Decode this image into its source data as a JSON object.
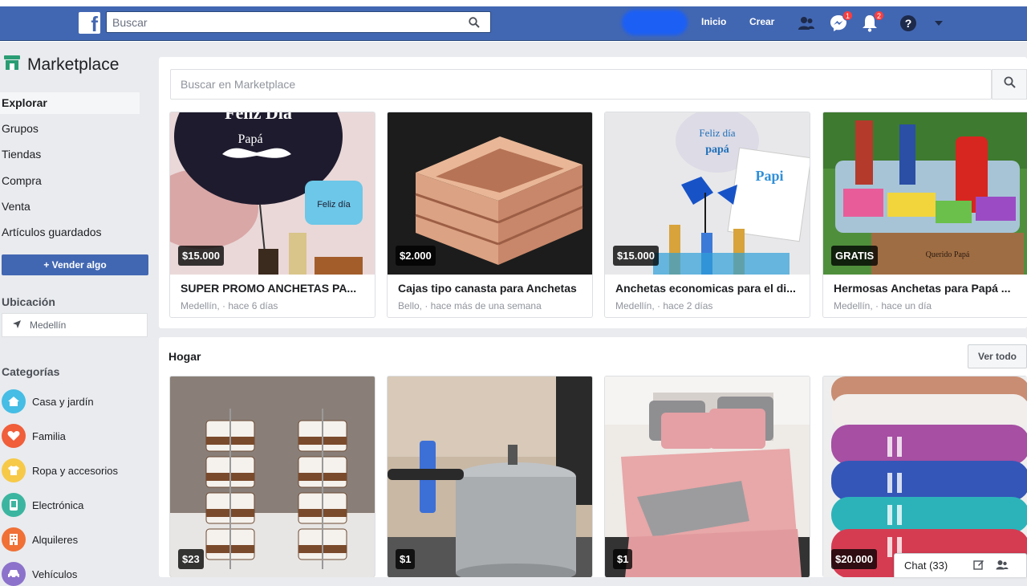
{
  "colors": {
    "brand": "#4267b2",
    "sell_button": "#4267b2",
    "badge": "#fa3e3e"
  },
  "topbar": {
    "search_placeholder": "Buscar",
    "home_label": "Inicio",
    "create_label": "Crear",
    "messages_badge": "1",
    "notifications_badge": "2"
  },
  "sidebar": {
    "title": "Marketplace",
    "items": [
      {
        "label": "Explorar",
        "active": true
      },
      {
        "label": "Grupos"
      },
      {
        "label": "Tiendas"
      },
      {
        "label": "Compra"
      },
      {
        "label": "Venta"
      },
      {
        "label": "Artículos guardados"
      }
    ],
    "sell_button": "+ Vender algo",
    "location_header": "Ubicación",
    "location_value": "Medellín",
    "categories_header": "Categorías",
    "categories": [
      {
        "label": "Casa y jardín",
        "icon": "house-icon",
        "color": "#45bde5"
      },
      {
        "label": "Familia",
        "icon": "heart-icon",
        "color": "#f05e3a"
      },
      {
        "label": "Ropa y accesorios",
        "icon": "shirt-icon",
        "color": "#f7c948"
      },
      {
        "label": "Electrónica",
        "icon": "phone-icon",
        "color": "#3cb5a0"
      },
      {
        "label": "Alquileres",
        "icon": "building-icon",
        "color": "#f07036"
      },
      {
        "label": "Vehículos",
        "icon": "car-icon",
        "color": "#8c72cb"
      }
    ]
  },
  "marketplace_search": {
    "placeholder": "Buscar en Marketplace"
  },
  "featured": [
    {
      "price": "$15.000",
      "title": "SUPER PROMO ANCHETAS PA...",
      "location": "Medellín, · hace 6 días"
    },
    {
      "price": "$2.000",
      "title": "Cajas tipo canasta para Anchetas",
      "location": "Bello, · hace más de una semana"
    },
    {
      "price": "$15.000",
      "title": "Anchetas economicas para el di...",
      "location": "Medellín, · hace 2 días"
    },
    {
      "price": "GRATIS",
      "title": "Hermosas Anchetas para Papá ...",
      "location": "Medellín, · hace un día"
    }
  ],
  "hogar": {
    "title": "Hogar",
    "see_all": "Ver todo",
    "items": [
      {
        "price": "$23"
      },
      {
        "price": "$1"
      },
      {
        "price": "$1"
      },
      {
        "price": "$20.000"
      }
    ]
  },
  "chat": {
    "label": "Chat (33)"
  }
}
